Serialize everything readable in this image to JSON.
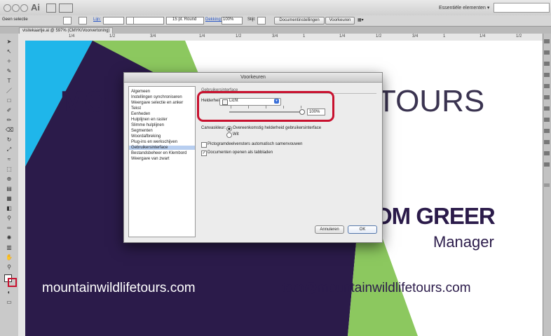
{
  "menubar": {
    "app_name": "Ai",
    "workspace": "Essentiële elementen ▾"
  },
  "controlbar": {
    "selection": "Geen selectie",
    "stroke_link": "Lijn:",
    "brush": "15 pt. Round",
    "opacity_link": "Dekking:",
    "opacity_value": "100%",
    "style_label": "Stijl:",
    "doc_settings_button": "Documentinstellingen",
    "preferences_button": "Voorkeuren"
  },
  "document": {
    "tab_label": "visitekaartje.ai @ 597% (CMYK/Voorvertoning)"
  },
  "ruler": {
    "marks": [
      "1/4",
      "1/2",
      "3/4",
      "1/4",
      "1/2",
      "3/4",
      "1",
      "1/4",
      "1/2",
      "3/4",
      "1",
      "1/4",
      "1/2"
    ]
  },
  "artboard": {
    "company_left": "MOU",
    "company_right": "TOURS",
    "person_name": "OM GREER",
    "person_role": "Manager",
    "website": "mountainwildlifetours.com",
    "email": "tom@mountainwildlifetours.com"
  },
  "dialog": {
    "title": "Voorkeuren",
    "categories": [
      "Algemeen",
      "Instellingen synchroniseren",
      "Weergave selectie en anker",
      "Tekst",
      "Eenheden",
      "Hulplijnen en raster",
      "Slimme hulplijnen",
      "Segmenten",
      "Woordafbreking",
      "Plug-ins en werkschijven",
      "Gebruikersinterface",
      "Bestandsbeheer en Klembord",
      "Weergave van zwart"
    ],
    "selected_category": "Gebruikersinterface",
    "section_title": "Gebruikersinterface",
    "brightness_label": "Helderheid:",
    "brightness_value": "Licht",
    "brightness_percent": "100%",
    "canvas_color_label": "Canvaskleur:",
    "canvas_option_1": "Overeenkomstig helderheid gebruikersinterface",
    "canvas_option_2": "Wit",
    "checkbox_1": "Pictogramdeelvensters automatisch samenvouwen",
    "checkbox_2": "Documenten openen als tabbladen",
    "cancel_button": "Annuleren",
    "ok_button": "OK"
  },
  "colors": {
    "card_green": "#8cc85f",
    "card_cyan": "#1fb6ea",
    "card_purple": "#2b1b4a",
    "highlight_red": "#c8102e"
  }
}
